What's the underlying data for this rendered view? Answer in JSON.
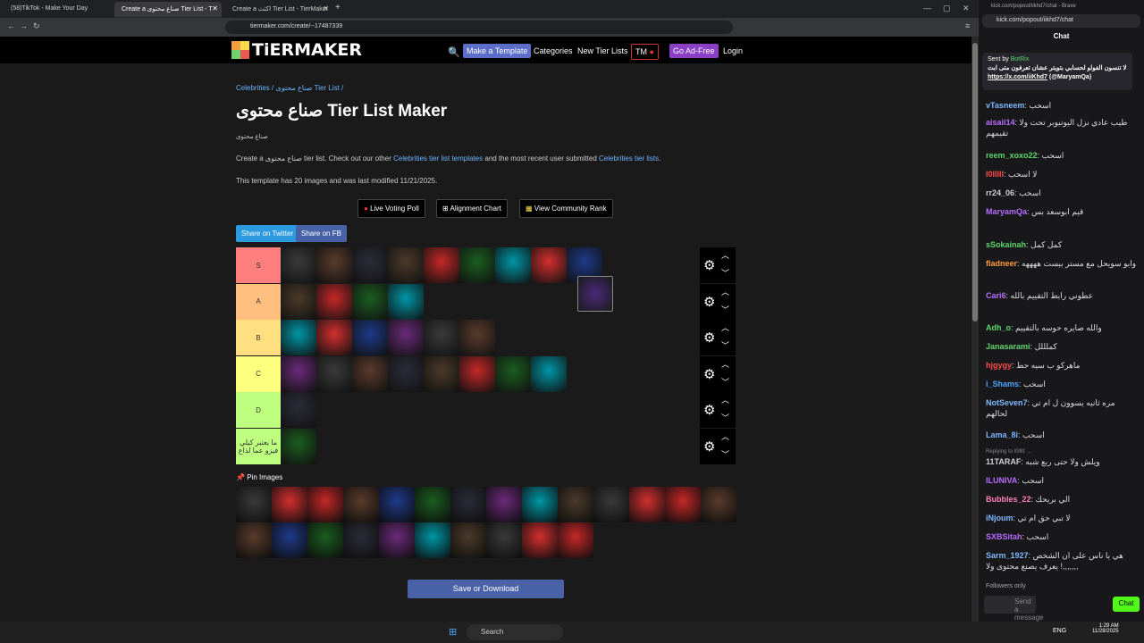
{
  "tabs": [
    {
      "label": "(58)TikTok - Make Your Day"
    },
    {
      "label": "Create a صناع محتوى Tier List - T"
    },
    {
      "label": "Create a اكثث Tier List - TierMaker"
    }
  ],
  "url": "tiermaker.com/create/--17487339",
  "nav": {
    "make": "Make a Template",
    "categories": "Categories",
    "new": "New Tier Lists",
    "tm": "TM",
    "adfree": "Go Ad-Free",
    "login": "Login"
  },
  "breadcrumb": "Celebrities / صناع محتوى Tier List /",
  "title": "صناع محتوى Tier List Maker",
  "subtitle": "صناع محتوى",
  "desc": {
    "a": "Create a صناع محتوى tier list. Check out our other",
    "b": "Celebrities tier list templates",
    "c": "and the most recent user submitted",
    "d": "Celebrities tier lists",
    "e": "."
  },
  "info": "This template has 20 images and was last modified 11/21/2025.",
  "buttons": {
    "poll": "Live Voting Poll",
    "align": "Alignment Chart",
    "community": "View Community Rank",
    "twitter": "Share on Twitter",
    "fb": "Share on FB",
    "save": "Save or Download"
  },
  "tiers": [
    {
      "label": "S",
      "color": "#ff7f7f"
    },
    {
      "label": "A",
      "color": "#ffbf7f"
    },
    {
      "label": "B",
      "color": "#ffdf80"
    },
    {
      "label": "C",
      "color": "#ffff7f"
    },
    {
      "label": "D",
      "color": "#bfff7f"
    },
    {
      "label": "ما يعتبر كيلي فيزو عما لذاع",
      "color": "#bfff7f"
    }
  ],
  "pin": "Pin Images",
  "chat": {
    "url": "kick.com/popout/iikhd7/chat",
    "tabtitle": "kick.com/popout/iikhd7/chat - Brave",
    "header": "Chat",
    "pinned_sender": "Sent by",
    "pinned_bot": "BotRix",
    "pinned_text": "لا تنسون الفولو لحسابي بتويتر عشان تعرفون متى ابث",
    "pinned_link": "https://x.com/iiKhd7",
    "pinned_handle": "(@MaryamQa)",
    "messages": [
      {
        "user": "vTasneem",
        "color": "#7db7ff",
        "text": "اسحب"
      },
      {
        "user": "aisaii14",
        "color": "#b66dff",
        "text": "طيب عادي نزل اليوتيوبر تحت ولا تقيمهم"
      },
      {
        "user": "reem_xoxo22",
        "color": "#5bd56b",
        "text": "اسحب"
      },
      {
        "user": "l0lllll",
        "color": "#ff4d4d",
        "text": "لا اسحب"
      },
      {
        "user": "rr24_06",
        "color": "#cfcfcf",
        "text": "اسحب"
      },
      {
        "user": "MaryamQa",
        "color": "#b66dff",
        "text": "قيم ابوسعد بس"
      },
      {
        "user": "sSokainah",
        "color": "#5bd56b",
        "text": "كمل كمل"
      },
      {
        "user": "fladneer",
        "color": "#ff9a3c",
        "text": "وابو سويحل مع مستر بيست ههههه"
      },
      {
        "user": "Cari6",
        "color": "#b66dff",
        "text": "عطوني رابط التقييم بالله"
      },
      {
        "user": "Adh_o",
        "color": "#5bd56b",
        "text": "والله صايره حوسه بالتقييم"
      },
      {
        "user": "Janasarami",
        "color": "#5bd56b",
        "text": "كملللل"
      },
      {
        "user": "hjgygy",
        "color": "#ff4d4d",
        "text": "ماهركو ب سيه حط"
      },
      {
        "user": "i_Shams",
        "color": "#4da6ff",
        "text": "اسحب"
      },
      {
        "user": "NotSeven7",
        "color": "#7db7ff",
        "text": "مره ثانيه يسوون ل ام تي لحالهم"
      },
      {
        "user": "Lama_8i",
        "color": "#7db7ff",
        "text": "اسحب"
      },
      {
        "user": "11TARAF",
        "color": "#cfcfcf",
        "text": "ويلش ولا حتى ربع شبه"
      },
      {
        "user": "ILUNIVA",
        "color": "#b66dff",
        "text": "اسحب"
      },
      {
        "user": "Bubbles_22",
        "color": "#ff7eb6",
        "text": "الي بريحك"
      },
      {
        "user": "iNjoum",
        "color": "#7db7ff",
        "text": "لا تبي حق ام تي"
      },
      {
        "user": "SXBSitah",
        "color": "#b66dff",
        "text": "اسحب"
      },
      {
        "user": "Sarm_1927",
        "color": "#7db7ff",
        "text": "هي يا ناس على ان الشخص يعرف يصنع محتوى ولا !,,,,,,,"
      }
    ],
    "reply": "Replying to l0lllll: ...",
    "followers": "Followers only",
    "input_placeholder": "Send a message",
    "send": "Chat"
  },
  "taskbar": {
    "search": "Search",
    "lang": "ENG",
    "time": "1:29 AM",
    "date": "11/28/2025"
  }
}
